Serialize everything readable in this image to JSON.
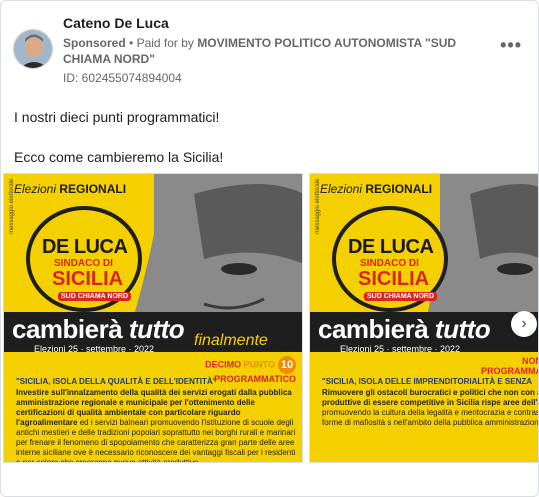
{
  "post": {
    "author": "Cateno De Luca",
    "sponsored": "Sponsored",
    "separator": "•",
    "paid_for": "Paid for by",
    "payer": "MOVIMENTO POLITICO AUTONOMISTA \"SUD CHIAMA NORD\"",
    "id": "ID: 602455074894004",
    "more_icon": "more-horizontal-icon",
    "text_line_1": "I nostri dieci punti programmatici!",
    "text_line_2": "Ecco come cambieremo la Sicilia!"
  },
  "slides": [
    {
      "elezioni": "Elezioni",
      "regionali": "REGIONALI",
      "vertical_label": "messaggio elettorale",
      "badge_name": "DE LUCA",
      "badge_sindaco": "SINDACO DI",
      "badge_region": "SICILIA",
      "badge_party": "SUD CHIAMA NORD",
      "slogan_a": "cambierà",
      "slogan_b": "tutto",
      "slogan_c": "finalmente",
      "date": "Elezioni  25 · settembre · 2022",
      "punto_a": "DECIMO",
      "punto_b": "PUNTO",
      "punto_c": "PROGRAMMATICO",
      "punto_num": "10",
      "quote": "\"SICILIA, ISOLA DELLA QUALITÀ E DELL'IDENTITÀ\"",
      "para_lead": "Investire sull'innalzamento della qualità dei servizi erogati dalla pubblica amministrazione regionale e municipale per l'ottenimento delle certificazioni di qualità ambientale con particolare riguardo l'agroalimentare",
      "para_rest": " ed i servizi balneari promuovendo l'istituzione di scuole degli antichi mestieri e delle tradizioni popolari soprattutto nei borghi rurali e marinari per frenare il fenomeno di spopolamento che caratterizza gran parte delle aree interne siciliane ove è necessario riconoscere dei vantaggi fiscali per i residenti e per coloro che creeranno nuove attività produttive."
    },
    {
      "elezioni": "Elezioni",
      "regionali": "REGIONALI",
      "vertical_label": "messaggio elettorale",
      "badge_name": "DE LUCA",
      "badge_sindaco": "SINDACO DI",
      "badge_region": "SICILIA",
      "badge_party": "SUD CHIAMA NORD",
      "slogan_a": "cambierà",
      "slogan_b": "tutto",
      "date": "Elezioni  25 · settembre · 2022",
      "punto_a": "NON",
      "punto_c": "PROGRAMMA",
      "quote": "\"SICILIA, ISOLA DELLE IMPRENDITORIALITÀ E SENZA",
      "para_lead": "Rimuovere gli ostacoli burocratici e politici che non con attività produttive di essere competitive in Sicilia rispe aree dell'Europa",
      "para_rest": " promuovendo la cultura della legalità e meritocrazia e contrastando tutte le forme di mafiosità s nell'ambito della pubblica amministrazione regionale."
    }
  ],
  "carousel": {
    "next_icon": "chevron-right-icon",
    "next_glyph": "›"
  }
}
